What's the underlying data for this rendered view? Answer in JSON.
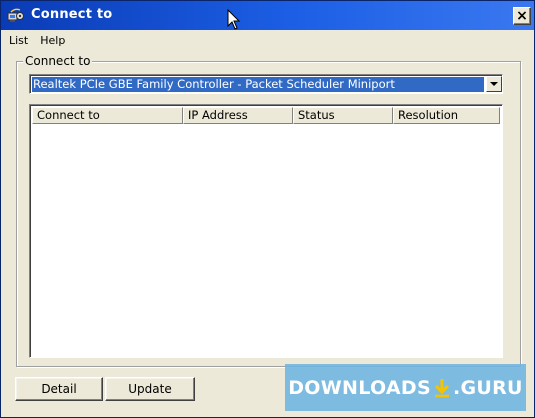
{
  "window": {
    "title": "Connect to",
    "close_label": "×"
  },
  "menu": {
    "items": [
      "List",
      "Help"
    ]
  },
  "group": {
    "label": "Connect to"
  },
  "adapter_dropdown": {
    "selected": "Realtek PCIe GBE Family Controller - Packet Scheduler Miniport"
  },
  "list": {
    "columns": [
      "Connect to",
      "IP Address",
      "Status",
      "Resolution"
    ],
    "rows": []
  },
  "buttons": {
    "detail": "Detail",
    "update": "Update"
  },
  "watermark": {
    "left": "DOWNLOADS",
    "right": ".GURU"
  },
  "colors": {
    "titlebar": "#0a3bb5",
    "selection": "#316ac5",
    "face": "#ece9d8",
    "watermark_bg": "#6eb4e1",
    "watermark_arrow": "#f5c400"
  },
  "icons": {
    "title": "network-connect-icon",
    "cursor": "mouse-pointer-icon",
    "dropdown": "chevron-down-icon",
    "watermark": "download-arrow-icon"
  }
}
